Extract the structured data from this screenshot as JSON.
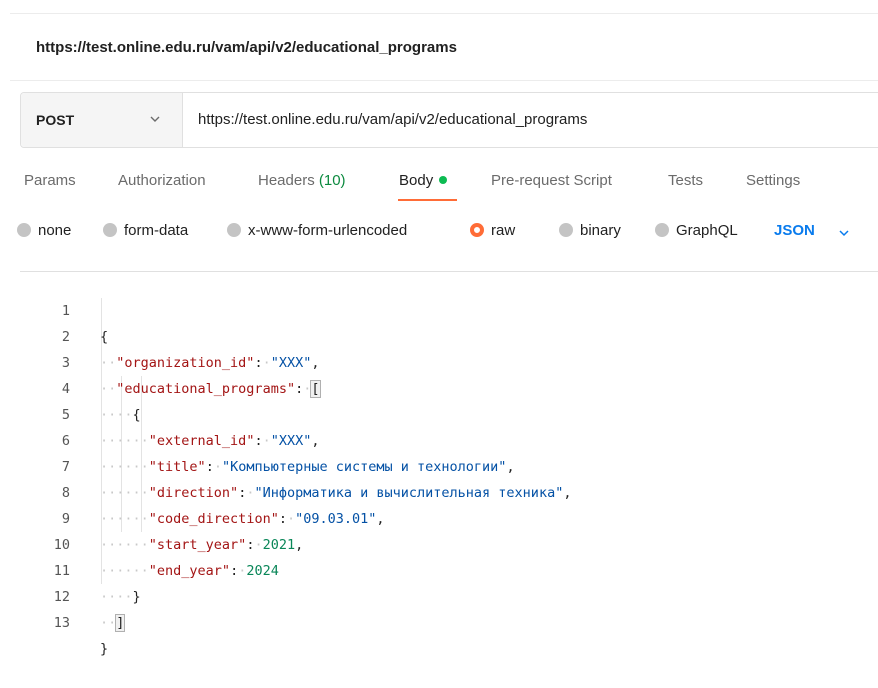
{
  "request_title": "https://test.online.edu.ru/vam/api/v2/educational_programs",
  "request": {
    "method": "POST",
    "method_chevron_icon": "chevron-down-icon",
    "url": "https://test.online.edu.ru/vam/api/v2/educational_programs"
  },
  "tabs": [
    {
      "label": "Params"
    },
    {
      "label": "Authorization"
    },
    {
      "label": "Headers",
      "count": "(10)"
    },
    {
      "label": "Body",
      "active": true,
      "indicator_color": "#0cbb52"
    },
    {
      "label": "Pre-request Script"
    },
    {
      "label": "Tests"
    },
    {
      "label": "Settings"
    }
  ],
  "body_types": [
    {
      "label": "none"
    },
    {
      "label": "form-data"
    },
    {
      "label": "x-www-form-urlencoded"
    },
    {
      "label": "raw",
      "selected": true
    },
    {
      "label": "binary"
    },
    {
      "label": "GraphQL"
    }
  ],
  "body_format": "JSON",
  "colors": {
    "accent": "#ff6c37",
    "link": "#097bed",
    "json_key": "#a31515",
    "json_string": "#0451a5",
    "json_number": "#098658"
  },
  "code": {
    "line_numbers": [
      "1",
      "2",
      "3",
      "4",
      "5",
      "6",
      "7",
      "8",
      "9",
      "10",
      "11",
      "12",
      "13"
    ],
    "tokens": {
      "open_brace": "{",
      "close_brace": "}",
      "open_bracket": "[",
      "close_bracket": "]",
      "colon": ":",
      "comma": ",",
      "k_organization_id": "\"organization_id\"",
      "v_organization_id": "\"XXX\"",
      "k_educational_programs": "\"educational_programs\"",
      "k_external_id": "\"external_id\"",
      "v_external_id": "\"XXX\"",
      "k_title": "\"title\"",
      "v_title": "\"Компьютерные системы и технологии\"",
      "k_direction": "\"direction\"",
      "v_direction": "\"Информатика и вычислительная техника\"",
      "k_code_direction": "\"code_direction\"",
      "v_code_direction": "\"09.03.01\"",
      "k_start_year": "\"start_year\"",
      "v_start_year": "2021",
      "k_end_year": "\"end_year\"",
      "v_end_year": "2024"
    }
  }
}
